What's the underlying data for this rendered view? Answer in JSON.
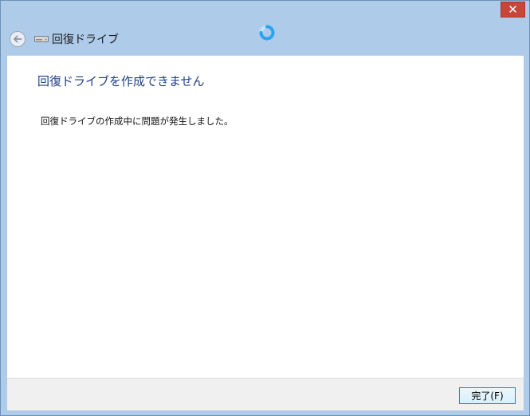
{
  "window": {
    "title": "回復ドライブ",
    "close_glyph": "✕",
    "accent_color": "#aecbea",
    "close_color": "#c7453a"
  },
  "icons": {
    "back": "back-arrow-icon",
    "drive": "drive-icon",
    "busy": "busy-spinner-icon"
  },
  "content": {
    "heading": "回復ドライブを作成できません",
    "message": "回復ドライブの作成中に問題が発生しました。",
    "heading_color": "#1e3f86"
  },
  "footer": {
    "finish_label": "完了(F)"
  }
}
